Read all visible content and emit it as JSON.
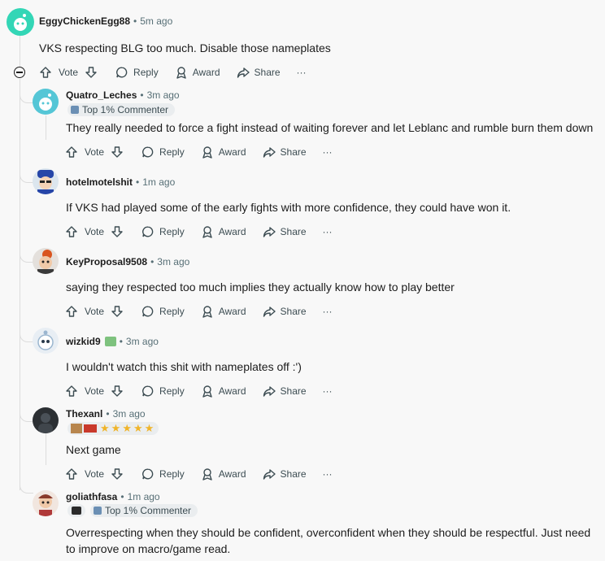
{
  "actions": {
    "vote": "Vote",
    "reply": "Reply",
    "award": "Award",
    "share": "Share",
    "more": "···"
  },
  "top_comment": {
    "user": "EggyChickenEgg88",
    "time": "5m ago",
    "text": "VKS respecting BLG too much. Disable those nameplates",
    "avatar_color": "#33d6b6"
  },
  "replies": [
    {
      "user": "Quatro_Leches",
      "time": "3m ago",
      "flair": "Top 1% Commenter",
      "text": "They really needed to force a fight instead of waiting forever and let Leblanc and rumble burn them down",
      "avatar_color": "#55c6d6"
    },
    {
      "user": "hotelmotelshit",
      "time": "1m ago",
      "text": "If VKS had played some of the early fights with more confidence, they could have won it.",
      "avatar_color": "#2746a8"
    },
    {
      "user": "KeyProposal9508",
      "time": "3m ago",
      "text": "saying they respected too much implies they actually know how to play better",
      "avatar_color": "#d9541e"
    },
    {
      "user": "wizkid9",
      "time": "3m ago",
      "text": "I wouldn't watch this shit with nameplates off :')",
      "avatar_color": "#9bb6cf"
    },
    {
      "user": "Thexanl",
      "time": "3m ago",
      "text": "Next game",
      "avatar_color": "#2b2f33"
    },
    {
      "user": "goliathfasa",
      "time": "1m ago",
      "flair": "Top 1% Commenter",
      "text": "Overrespecting when they should be confident, overconfident when they should be respectful. Just need to improve on macro/game read.",
      "avatar_color": "#e6b8a0"
    }
  ],
  "dot": "•"
}
